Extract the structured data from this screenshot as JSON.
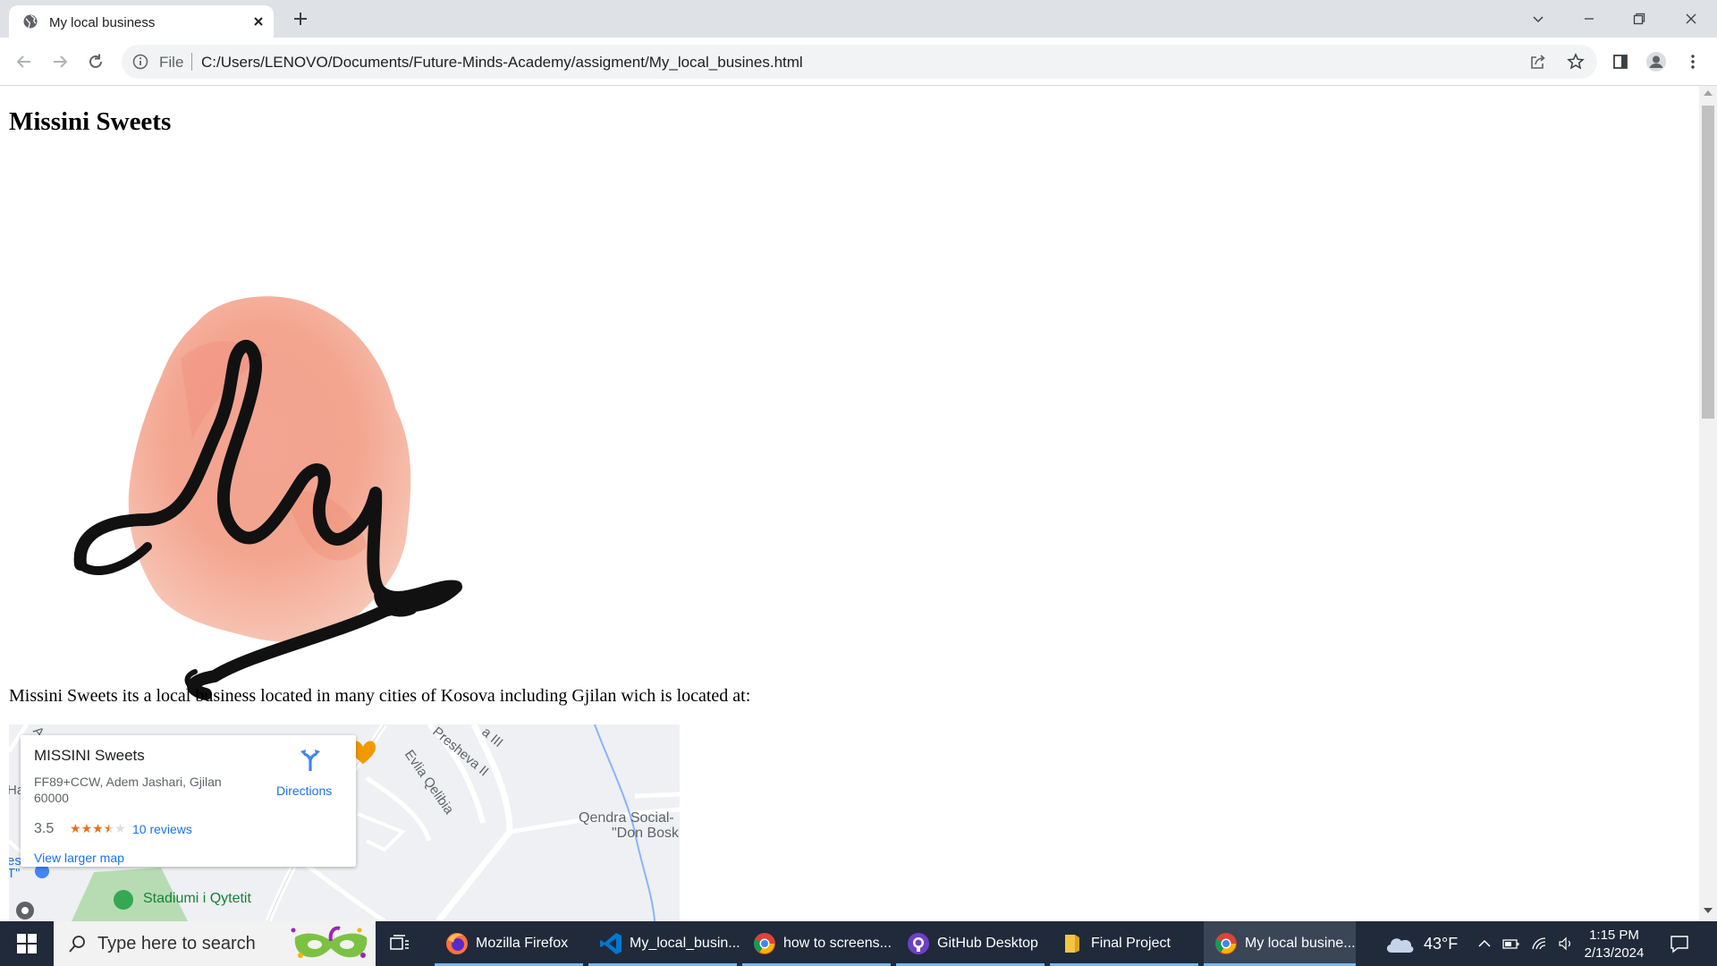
{
  "tab": {
    "title": "My local business"
  },
  "toolbar": {
    "scheme": "File",
    "url": "C:/Users/LENOVO/Documents/Future-Minds-Academy/assigment/My_local_busines.html"
  },
  "page": {
    "title": "Missini Sweets",
    "description": "Missini Sweets its a local business located in many cities of Kosova including Gjilan wich is located at:"
  },
  "map": {
    "business_name": "MISSINI Sweets",
    "address": "FF89+CCW, Adem Jashari, Gjilan 60000",
    "rating": "3.5",
    "stars_value": 3.5,
    "stars_max": 5,
    "reviews": "10 reviews",
    "view_larger": "View larger map",
    "directions": "Directions",
    "labels": {
      "road_presheva": "Presheva II",
      "road_presheva_top": "a III",
      "road_evlia": "Evlia Qelibia",
      "social_center_1": "Qendra Social-",
      "social_center_2": "\"Don Bosk",
      "stadium": "Stadiumi i Qytetit",
      "edge_left_1": "Ha",
      "edge_left_2": "es",
      "edge_left_3": "T\"",
      "edge_top": "A"
    }
  },
  "taskbar": {
    "search_placeholder": "Type here to search",
    "apps": [
      {
        "label": "Mozilla Firefox",
        "icon": "firefox-icon"
      },
      {
        "label": "My_local_busin...",
        "icon": "vscode-icon"
      },
      {
        "label": "how to screens...",
        "icon": "chrome-icon"
      },
      {
        "label": "GitHub Desktop",
        "icon": "github-icon"
      },
      {
        "label": "Final Project",
        "icon": "folder-icon"
      },
      {
        "label": "My local busine...",
        "icon": "chrome-icon"
      }
    ],
    "weather": "43°F",
    "time": "1:15 PM",
    "date": "2/13/2024"
  },
  "colors": {
    "link": "#1a73e8",
    "star": "#e7711b",
    "taskbar": "#202a3a",
    "tabstrip": "#dee1e6"
  }
}
